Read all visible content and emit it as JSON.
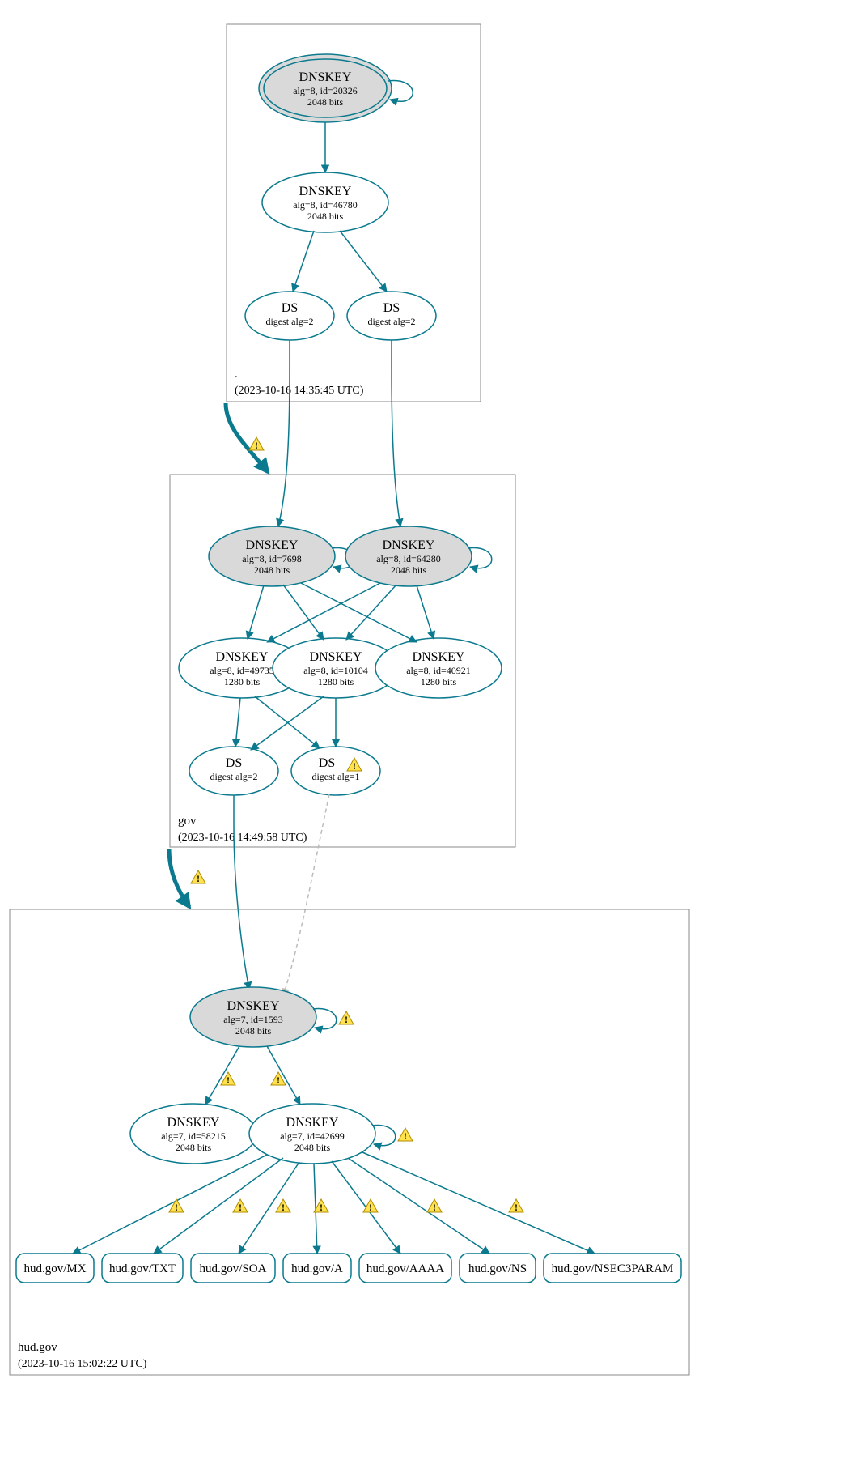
{
  "zones": {
    "root": {
      "name": ".",
      "timestamp": "(2023-10-16 14:35:45 UTC)"
    },
    "gov": {
      "name": "gov",
      "timestamp": "(2023-10-16 14:49:58 UTC)"
    },
    "hud": {
      "name": "hud.gov",
      "timestamp": "(2023-10-16 15:02:22 UTC)"
    }
  },
  "nodes": {
    "root_ksk": {
      "title": "DNSKEY",
      "l2": "alg=8, id=20326",
      "l3": "2048 bits"
    },
    "root_zsk": {
      "title": "DNSKEY",
      "l2": "alg=8, id=46780",
      "l3": "2048 bits"
    },
    "root_ds1": {
      "title": "DS",
      "l2": "digest alg=2"
    },
    "root_ds2": {
      "title": "DS",
      "l2": "digest alg=2"
    },
    "gov_ksk1": {
      "title": "DNSKEY",
      "l2": "alg=8, id=7698",
      "l3": "2048 bits"
    },
    "gov_ksk2": {
      "title": "DNSKEY",
      "l2": "alg=8, id=64280",
      "l3": "2048 bits"
    },
    "gov_zsk1": {
      "title": "DNSKEY",
      "l2": "alg=8, id=49735",
      "l3": "1280 bits"
    },
    "gov_zsk2": {
      "title": "DNSKEY",
      "l2": "alg=8, id=10104",
      "l3": "1280 bits"
    },
    "gov_zsk3": {
      "title": "DNSKEY",
      "l2": "alg=8, id=40921",
      "l3": "1280 bits"
    },
    "gov_ds1": {
      "title": "DS",
      "l2": "digest alg=2"
    },
    "gov_ds2": {
      "title": "DS",
      "l2": "digest alg=1"
    },
    "hud_ksk": {
      "title": "DNSKEY",
      "l2": "alg=7, id=1593",
      "l3": "2048 bits"
    },
    "hud_zsk1": {
      "title": "DNSKEY",
      "l2": "alg=7, id=58215",
      "l3": "2048 bits"
    },
    "hud_zsk2": {
      "title": "DNSKEY",
      "l2": "alg=7, id=42699",
      "l3": "2048 bits"
    }
  },
  "rrsets": [
    "hud.gov/MX",
    "hud.gov/TXT",
    "hud.gov/SOA",
    "hud.gov/A",
    "hud.gov/AAAA",
    "hud.gov/NS",
    "hud.gov/NSEC3PARAM"
  ]
}
